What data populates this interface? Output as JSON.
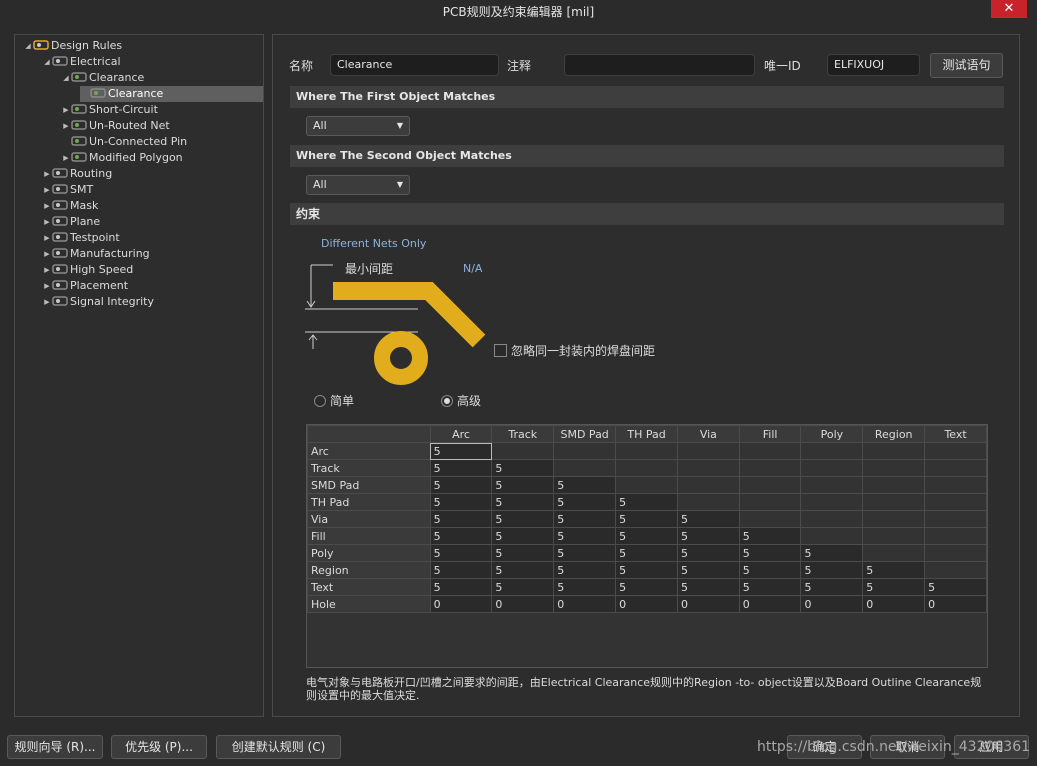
{
  "window": {
    "title": "PCB规则及约束编辑器 [mil]",
    "close_label": "✕"
  },
  "tree": [
    {
      "label": "Design Rules",
      "level": 0,
      "arrow": "◢",
      "icon": "rules-folder-icon"
    },
    {
      "label": "Electrical",
      "level": 1,
      "arrow": "◢",
      "icon": "electrical-icon"
    },
    {
      "label": "Clearance",
      "level": 2,
      "arrow": "◢",
      "icon": "clearance-icon"
    },
    {
      "label": "Clearance",
      "level": 3,
      "arrow": "",
      "icon": "clearance-rule-icon",
      "selected": true
    },
    {
      "label": "Short-Circuit",
      "level": 2,
      "arrow": "▶",
      "icon": "short-circuit-icon"
    },
    {
      "label": "Un-Routed Net",
      "level": 2,
      "arrow": "▶",
      "icon": "unrouted-net-icon"
    },
    {
      "label": "Un-Connected Pin",
      "level": 2,
      "arrow": "",
      "icon": "unconnected-pin-icon"
    },
    {
      "label": "Modified Polygon",
      "level": 2,
      "arrow": "▶",
      "icon": "modified-polygon-icon"
    },
    {
      "label": "Routing",
      "level": 1,
      "arrow": "▶",
      "icon": "routing-icon"
    },
    {
      "label": "SMT",
      "level": 1,
      "arrow": "▶",
      "icon": "smt-icon"
    },
    {
      "label": "Mask",
      "level": 1,
      "arrow": "▶",
      "icon": "mask-icon"
    },
    {
      "label": "Plane",
      "level": 1,
      "arrow": "▶",
      "icon": "plane-icon"
    },
    {
      "label": "Testpoint",
      "level": 1,
      "arrow": "▶",
      "icon": "testpoint-icon"
    },
    {
      "label": "Manufacturing",
      "level": 1,
      "arrow": "▶",
      "icon": "manufacturing-icon"
    },
    {
      "label": "High Speed",
      "level": 1,
      "arrow": "▶",
      "icon": "high-speed-icon"
    },
    {
      "label": "Placement",
      "level": 1,
      "arrow": "▶",
      "icon": "placement-icon"
    },
    {
      "label": "Signal Integrity",
      "level": 1,
      "arrow": "▶",
      "icon": "signal-integrity-icon"
    }
  ],
  "form": {
    "name_label": "名称",
    "name_value": "Clearance",
    "comment_label": "注释",
    "comment_value": "",
    "uid_label": "唯一ID",
    "uid_value": "ELFIXUOJ",
    "test_button": "测试语句"
  },
  "first_match": {
    "title": "Where The First Object Matches",
    "value": "All"
  },
  "second_match": {
    "title": "Where The Second Object Matches",
    "value": "All"
  },
  "constraints": {
    "title": "约束",
    "net_scope": "Different Nets Only",
    "min_clearance_label": "最小间距",
    "min_clearance_value": "N/A",
    "ignore_pads_label": "忽略同一封装内的焊盘间距",
    "mode_simple": "简单",
    "mode_advanced": "高级",
    "mode_selected": "advanced"
  },
  "matrix": {
    "columns": [
      "Arc",
      "Track",
      "SMD Pad",
      "TH Pad",
      "Via",
      "Fill",
      "Poly",
      "Region",
      "Text"
    ],
    "rows": [
      {
        "name": "Arc",
        "values": [
          "5"
        ]
      },
      {
        "name": "Track",
        "values": [
          "5",
          "5"
        ]
      },
      {
        "name": "SMD Pad",
        "values": [
          "5",
          "5",
          "5"
        ]
      },
      {
        "name": "TH Pad",
        "values": [
          "5",
          "5",
          "5",
          "5"
        ]
      },
      {
        "name": "Via",
        "values": [
          "5",
          "5",
          "5",
          "5",
          "5"
        ]
      },
      {
        "name": "Fill",
        "values": [
          "5",
          "5",
          "5",
          "5",
          "5",
          "5"
        ]
      },
      {
        "name": "Poly",
        "values": [
          "5",
          "5",
          "5",
          "5",
          "5",
          "5",
          "5"
        ]
      },
      {
        "name": "Region",
        "values": [
          "5",
          "5",
          "5",
          "5",
          "5",
          "5",
          "5",
          "5"
        ]
      },
      {
        "name": "Text",
        "values": [
          "5",
          "5",
          "5",
          "5",
          "5",
          "5",
          "5",
          "5",
          "5"
        ]
      },
      {
        "name": "Hole",
        "values": [
          "0",
          "0",
          "0",
          "0",
          "0",
          "0",
          "0",
          "0",
          "0"
        ]
      }
    ]
  },
  "note": "电气对象与电路板开口/凹槽之间要求的间距，由Electrical Clearance规则中的Region -to- object设置以及Board Outline Clearance规则设置中的最大值决定.",
  "footer": {
    "rule_wizard": "规则向导 (R)...",
    "priority": "优先级 (P)...",
    "create_default": "创建默认规则 (C)",
    "ok": "确定",
    "cancel": "取消",
    "apply": "应用"
  },
  "watermark": "https://blog.csdn.net/weixin_43206361",
  "colors": {
    "accent": "#e2ad1d",
    "background": "#2b2b2b",
    "selection": "#5f5f5f",
    "close": "#c8232b"
  }
}
